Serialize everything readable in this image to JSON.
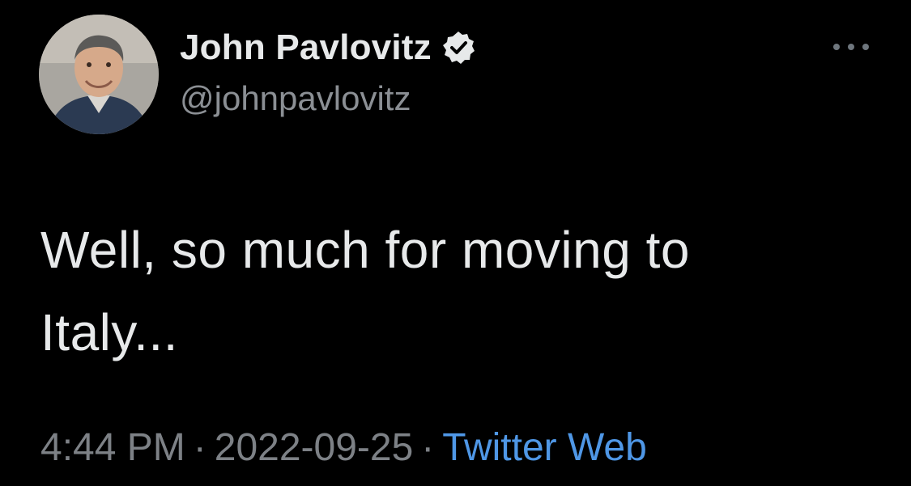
{
  "tweet": {
    "author": {
      "display_name": "John Pavlovitz",
      "handle": "@johnpavlovitz",
      "verified_icon": "verified-badge-icon",
      "avatar": "profile-photo"
    },
    "more_icon": "more-options-icon",
    "text": "Well, so much for moving to\nItaly...",
    "time": "4:44 PM",
    "date": "2022-09-25",
    "separator": "·",
    "source": "Twitter Web"
  },
  "colors": {
    "background": "#000000",
    "name": "#e7e9ea",
    "handle": "#8b8f94",
    "meta": "#7d8186",
    "source_link": "#4f97e6"
  }
}
